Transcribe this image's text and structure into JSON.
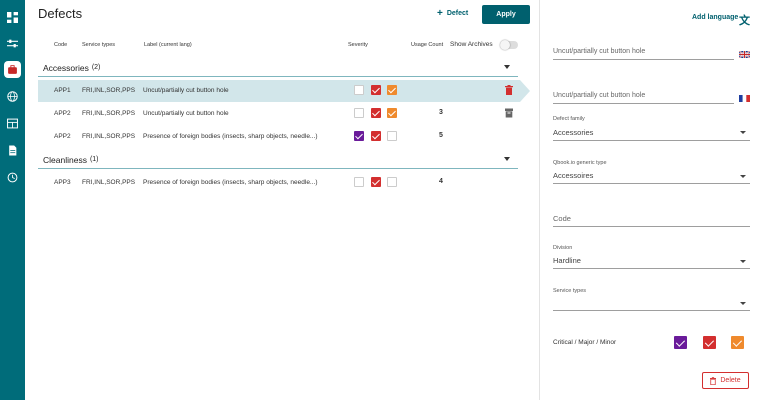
{
  "page": {
    "title": "Defects"
  },
  "toolbar": {
    "add_defect_label": "Defect",
    "apply_label": "Apply"
  },
  "table": {
    "headers": {
      "code": "Code",
      "service_types": "Service types",
      "label": "Label (current lang)",
      "severity": "Severity",
      "usage_count": "Usage Count"
    },
    "show_archives_label": "Show Archives",
    "show_archives_on": false
  },
  "groups": [
    {
      "name": "Accessories",
      "count": "(2)",
      "rows": [
        {
          "code": "APP1",
          "service_types": "FRI,INL,SOR,PPS",
          "label": "Uncut/partially cut button hole",
          "critical": false,
          "major": true,
          "minor": true,
          "usage": "",
          "selected": true,
          "action": "trash-icon"
        },
        {
          "code": "APP2",
          "service_types": "FRI,INL,SOR,PPS",
          "label": "Uncut/partially cut button hole",
          "critical": false,
          "major": true,
          "minor": true,
          "usage": "3",
          "selected": false,
          "action": "archive-icon"
        },
        {
          "code": "APP2",
          "service_types": "FRI,INL,SOR,PPS",
          "label": "Presence of foreign bodies (insects, sharp objects, needle...)",
          "critical": true,
          "major": true,
          "minor": false,
          "usage": "5",
          "selected": false,
          "action": ""
        }
      ]
    },
    {
      "name": "Cleanliness",
      "count": "(1)",
      "rows": [
        {
          "code": "APP3",
          "service_types": "FRI,INL,SOR,PPS",
          "label": "Presence of foreign bodies (insects, sharp objects, needle...)",
          "critical": false,
          "major": true,
          "minor": false,
          "usage": "4",
          "selected": false,
          "action": ""
        }
      ]
    }
  ],
  "panel": {
    "add_language_label": "Add language",
    "label_en": "Uncut/partially cut button hole",
    "label_fr": "Uncut/partially cut button hole",
    "defect_family": {
      "label": "Defect family",
      "value": "Accessories"
    },
    "qbook_type": {
      "label": "Qbook.io generic type",
      "value": "Accessoires"
    },
    "code": {
      "placeholder": "Code"
    },
    "division": {
      "label": "Division",
      "value": "Hardline"
    },
    "service_types": {
      "label": "Service types",
      "value": ""
    },
    "severity_label": "Critical / Major / Minor",
    "severity": {
      "critical": true,
      "major": true,
      "minor": true
    },
    "delete_label": "Delete"
  },
  "colors": {
    "accent": "#00606e",
    "critical": "#6a1b9a",
    "major": "#d32f2f",
    "minor": "#ef8a2d"
  }
}
